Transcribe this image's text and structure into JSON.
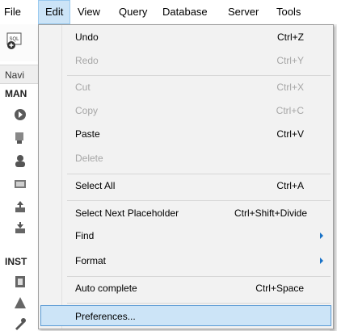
{
  "menubar": {
    "items": [
      {
        "label": "File"
      },
      {
        "label": "Edit"
      },
      {
        "label": "View"
      },
      {
        "label": "Query"
      },
      {
        "label": "Database"
      },
      {
        "label": "Server"
      },
      {
        "label": "Tools"
      }
    ]
  },
  "toolbar": {
    "sql_icon_text": "SQL"
  },
  "navigator": {
    "header": "Navi",
    "sections": [
      {
        "label": "MAN"
      },
      {
        "label": "INST"
      }
    ]
  },
  "edit_menu": {
    "items": [
      {
        "label": "Undo",
        "shortcut": "Ctrl+Z",
        "enabled": true
      },
      {
        "label": "Redo",
        "shortcut": "Ctrl+Y",
        "enabled": false
      },
      {
        "label": "Cut",
        "shortcut": "Ctrl+X",
        "enabled": false
      },
      {
        "label": "Copy",
        "shortcut": "Ctrl+C",
        "enabled": false
      },
      {
        "label": "Paste",
        "shortcut": "Ctrl+V",
        "enabled": true
      },
      {
        "label": "Delete",
        "shortcut": "",
        "enabled": false
      },
      {
        "label": "Select All",
        "shortcut": "Ctrl+A",
        "enabled": true
      },
      {
        "label": "Select Next Placeholder",
        "shortcut": "Ctrl+Shift+Divide",
        "enabled": true
      },
      {
        "label": "Find",
        "shortcut": "",
        "enabled": true,
        "submenu": true
      },
      {
        "label": "Format",
        "shortcut": "",
        "enabled": true,
        "submenu": true
      },
      {
        "label": "Auto complete",
        "shortcut": "Ctrl+Space",
        "enabled": true
      },
      {
        "label": "Preferences...",
        "shortcut": "",
        "enabled": true,
        "highlighted": true
      }
    ]
  },
  "colors": {
    "highlight": "#cce4f7",
    "highlight_border": "#5b9bd5",
    "disabled_text": "#a6a6a6",
    "submenu_arrow": "#1a73c7"
  }
}
